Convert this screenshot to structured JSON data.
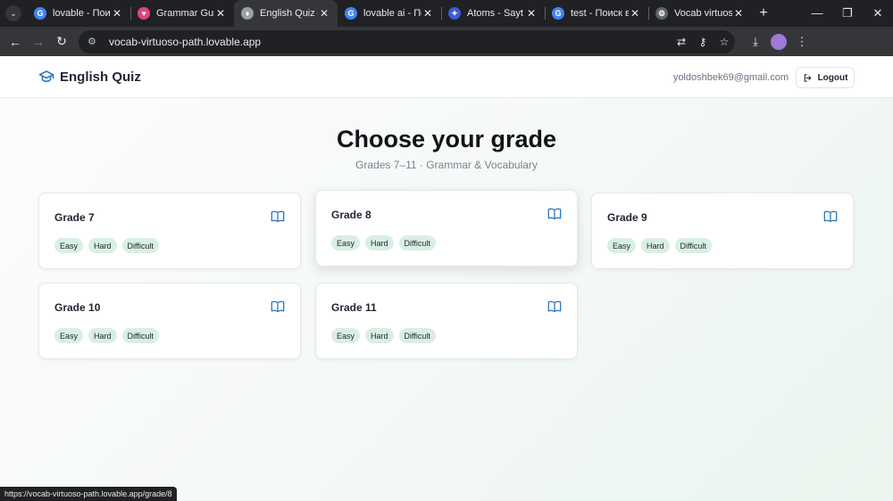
{
  "browser": {
    "tabs": [
      {
        "title": "lovable - Поиск в Google",
        "favicon_color": "#4285f4",
        "favicon_glyph": "G",
        "active": false
      },
      {
        "title": "Grammar Guru",
        "favicon_color": "#e0457b",
        "favicon_glyph": "♥",
        "active": false
      },
      {
        "title": "English Quiz — Grades",
        "favicon_color": "#9aa0a6",
        "favicon_glyph": "♦",
        "active": true
      },
      {
        "title": "lovable ai - Поиск в Google",
        "favicon_color": "#4285f4",
        "favicon_glyph": "G",
        "active": false
      },
      {
        "title": "Atoms - Sayt yaratish",
        "favicon_color": "#3b5bdb",
        "favicon_glyph": "✦",
        "active": false
      },
      {
        "title": "test - Поиск в Google",
        "favicon_color": "#4285f4",
        "favicon_glyph": "G",
        "active": false
      },
      {
        "title": "Vocab virtuoso path",
        "favicon_color": "#5f6368",
        "favicon_glyph": "⚙",
        "active": false
      }
    ],
    "url": "vocab-virtuoso-path.lovable.app",
    "status_url": "https://vocab-virtuoso-path.lovable.app/grade/8"
  },
  "header": {
    "brand_title": "English Quiz",
    "user_email": "yoldoshbek69@gmail.com",
    "logout_label": "Logout"
  },
  "hero": {
    "title": "Choose your grade",
    "subtitle": "Grades 7–11 · Grammar & Vocabulary"
  },
  "grades": [
    {
      "name": "Grade 7",
      "levels": [
        "Easy",
        "Hard",
        "Difficult"
      ]
    },
    {
      "name": "Grade 8",
      "levels": [
        "Easy",
        "Hard",
        "Difficult"
      ]
    },
    {
      "name": "Grade 9",
      "levels": [
        "Easy",
        "Hard",
        "Difficult"
      ]
    },
    {
      "name": "Grade 10",
      "levels": [
        "Easy",
        "Hard",
        "Difficult"
      ]
    },
    {
      "name": "Grade 11",
      "levels": [
        "Easy",
        "Hard",
        "Difficult"
      ]
    }
  ],
  "colors": {
    "accent": "#2e7bbf",
    "pill_bg": "#d9efe2"
  }
}
